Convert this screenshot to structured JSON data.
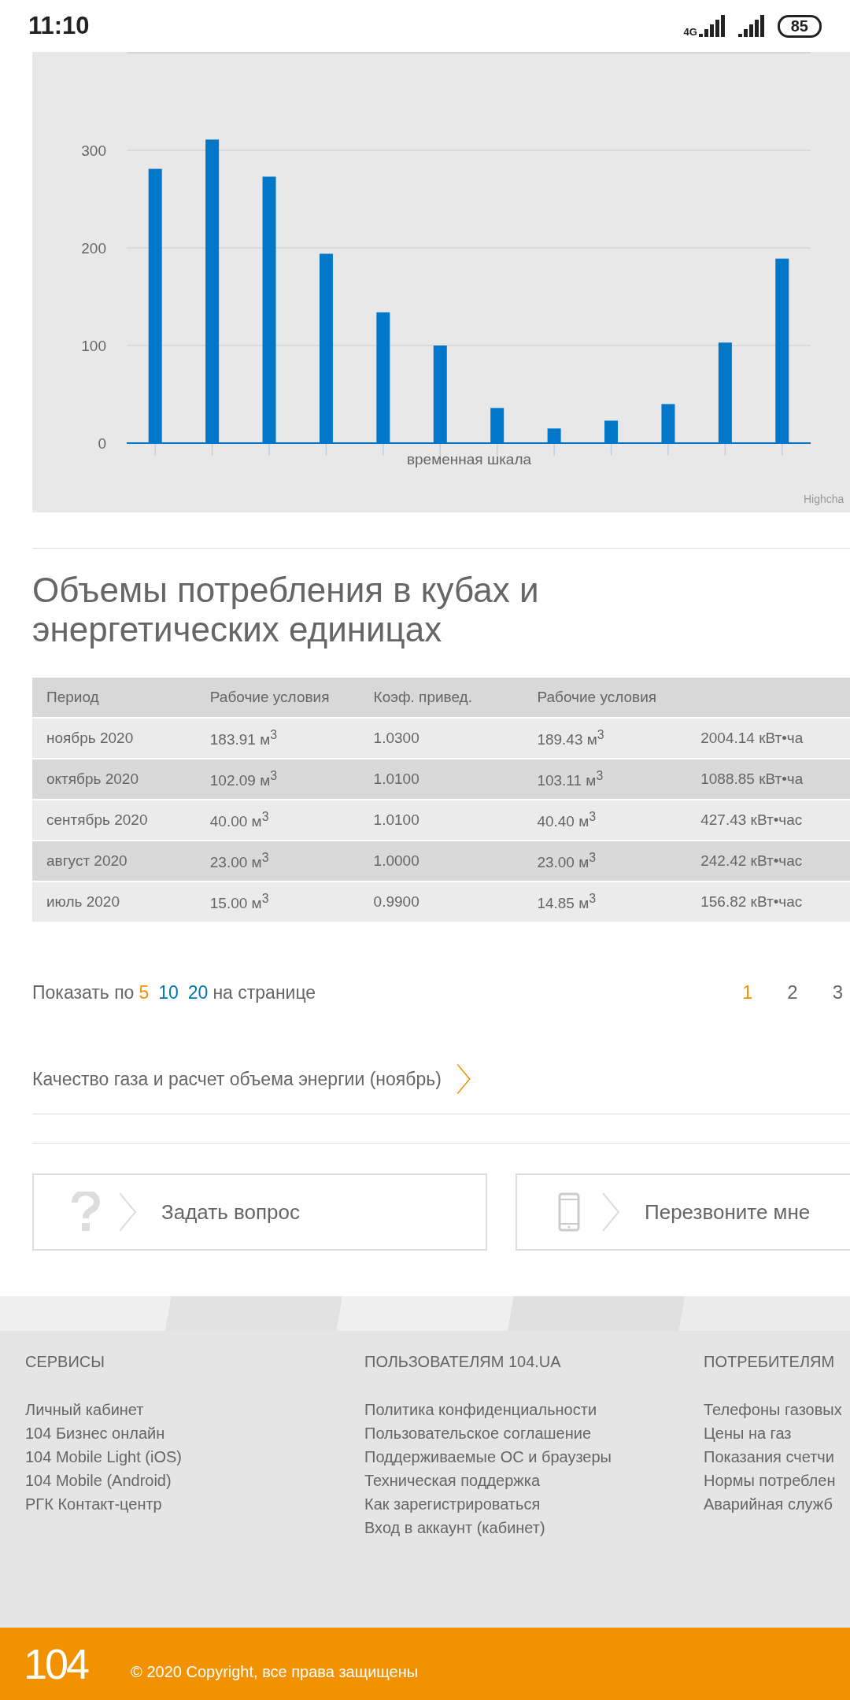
{
  "status_bar": {
    "time": "11:10",
    "network": "4G",
    "battery": "85"
  },
  "chart": {
    "credit": "Highcha",
    "chart_data": {
      "type": "bar",
      "xlabel": "временная шкала",
      "grid": true,
      "ylim": [
        0,
        400
      ],
      "yticks": [
        0,
        100,
        200,
        300
      ],
      "values": [
        281,
        311,
        273,
        194,
        134,
        100,
        36,
        15,
        23,
        40,
        103,
        189
      ]
    }
  },
  "section": {
    "title": "Объемы потребления в кубах и энергетических единицах"
  },
  "table": {
    "columns": [
      "Период",
      "Рабочие условия",
      "Коэф. привед.",
      "Рабочие условия"
    ],
    "rows": [
      [
        "ноябрь 2020",
        "183.91 м$^{3}$",
        "1.0300",
        "189.43 м$^{3}$",
        "2004.14 кВт•ча"
      ],
      [
        "октябрь 2020",
        "102.09 м$^{3}$",
        "1.0100",
        "103.11 м$^{3}$",
        "1088.85 кВт•ча"
      ],
      [
        "сентябрь 2020",
        "40.00 м$^{3}$",
        "1.0100",
        "40.40 м$^{3}$",
        "427.43 кВт•час"
      ],
      [
        "август 2020",
        "23.00 м$^{3}$",
        "1.0000",
        "23.00 м$^{3}$",
        "242.42 кВт•час"
      ],
      [
        "июль 2020",
        "15.00 м$^{3}$",
        "0.9900",
        "14.85 м$^{3}$",
        "156.82 кВт•час"
      ]
    ]
  },
  "pagination": {
    "prefix": "Показать по",
    "suffix": "на странице",
    "sizes": [
      {
        "label": "5",
        "selected": true
      },
      {
        "label": "10",
        "selected": false
      },
      {
        "label": "20",
        "selected": false
      }
    ],
    "pages": [
      {
        "label": "1",
        "selected": true
      },
      {
        "label": "2",
        "selected": false
      },
      {
        "label": "3",
        "selected": false
      }
    ]
  },
  "quality_link": "Качество газа и расчет объема энергии (ноябрь)",
  "actions": [
    {
      "kind": "question",
      "label": "Задать вопрос"
    },
    {
      "kind": "phone",
      "label": "Перезвоните мне"
    }
  ],
  "footer": {
    "columns": [
      {
        "title": "СЕРВИСЫ",
        "links": [
          "Личный кабинет",
          "104 Бизнес онлайн",
          "104 Mobile Light (iOS)",
          "104 Mobile (Android)",
          "РГК Контакт-центр"
        ]
      },
      {
        "title": "ПОЛЬЗОВАТЕЛЯМ 104.UA",
        "links": [
          "Политика конфиденциальности",
          "Пользовательское соглашение",
          "Поддерживаемые ОС и браузеры",
          "Техническая поддержка",
          "Как зарегистрироваться",
          "Вход в аккаунт (кабинет)"
        ]
      },
      {
        "title": "ПОТРЕБИТЕЛЯМ",
        "links": [
          "Телефоны газовых",
          "Цены на газ",
          "Показания счетчи",
          "Нормы потреблен",
          "Аварийная служб"
        ]
      }
    ],
    "logo": "104",
    "copyright": "© 2020 Copyright, все права защищены"
  }
}
